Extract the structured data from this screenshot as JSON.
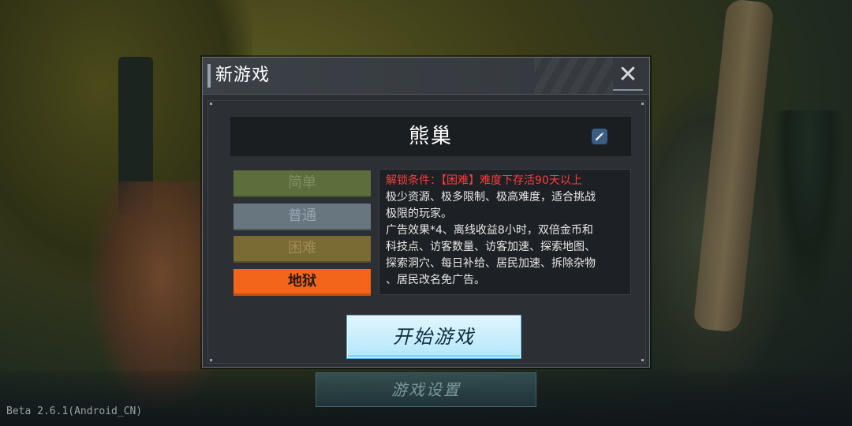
{
  "modal": {
    "title": "新游戏",
    "close_symbol": "✕",
    "close_icon": "close-icon",
    "edit_icon": "pencil-icon",
    "slot_name": "熊巢"
  },
  "difficulty": {
    "options": [
      {
        "label": "简单",
        "selected": false
      },
      {
        "label": "普通",
        "selected": false
      },
      {
        "label": "困难",
        "selected": false
      },
      {
        "label": "地狱",
        "selected": true
      }
    ],
    "selected_color": "#f3651a"
  },
  "description": {
    "unlock": "解锁条件：【困难】难度下存活90天以上",
    "lines": [
      "极少资源、极多限制、极高难度，适合挑战",
      "极限的玩家。",
      "广告效果*4、离线收益8小时，双倍金币和",
      "科技点、访客数量、访客加速、探索地图、",
      "探索洞穴、每日补给、居民加速、拆除杂物",
      "、居民改名免广告。"
    ],
    "unlock_color": "#ff3b3b"
  },
  "buttons": {
    "start": "开始游戏",
    "settings": "游戏设置"
  },
  "footer": {
    "version": "Beta 2.6.1(Android_CN)"
  }
}
